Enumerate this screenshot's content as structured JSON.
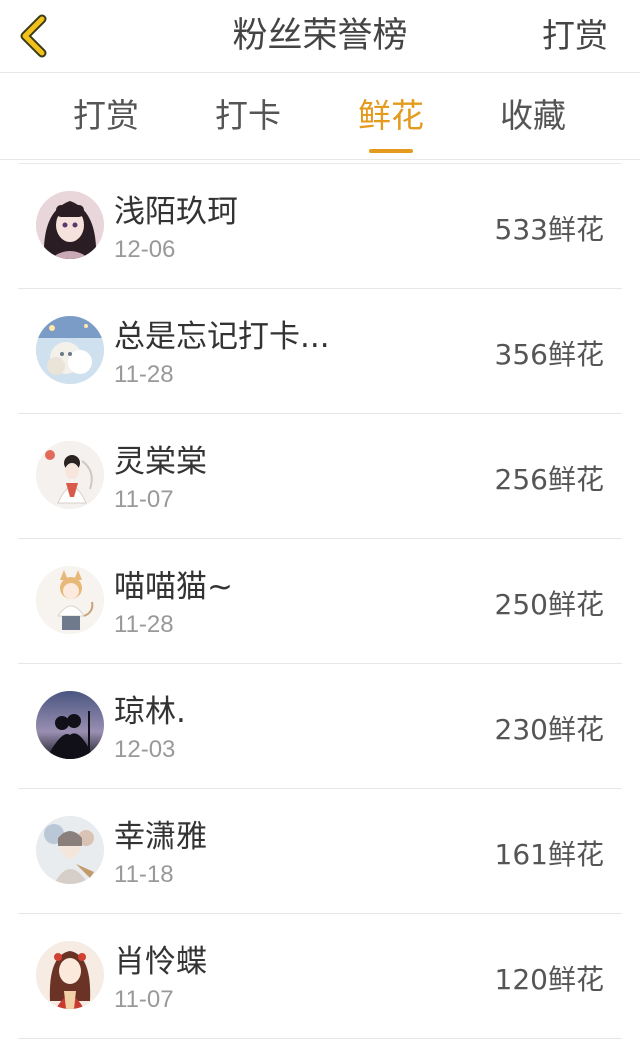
{
  "header": {
    "title": "粉丝荣誉榜",
    "action": "打赏",
    "accent_color": "#e39a1d"
  },
  "tabs": [
    {
      "label": "打赏",
      "active": false
    },
    {
      "label": "打卡",
      "active": false
    },
    {
      "label": "鲜花",
      "active": true
    },
    {
      "label": "收藏",
      "active": false
    }
  ],
  "rows": [
    {
      "name": "浅陌玖珂",
      "date": "12-06",
      "amount": "533鲜花"
    },
    {
      "name": "总是忘记打卡...",
      "date": "11-28",
      "amount": "356鲜花"
    },
    {
      "name": "灵棠棠",
      "date": "11-07",
      "amount": "256鲜花"
    },
    {
      "name": "喵喵猫~",
      "date": "11-28",
      "amount": "250鲜花"
    },
    {
      "name": "琼林.",
      "date": "12-03",
      "amount": "230鲜花"
    },
    {
      "name": "幸潇雅",
      "date": "11-18",
      "amount": "161鲜花"
    },
    {
      "name": "肖怜蝶",
      "date": "11-07",
      "amount": "120鲜花"
    }
  ]
}
